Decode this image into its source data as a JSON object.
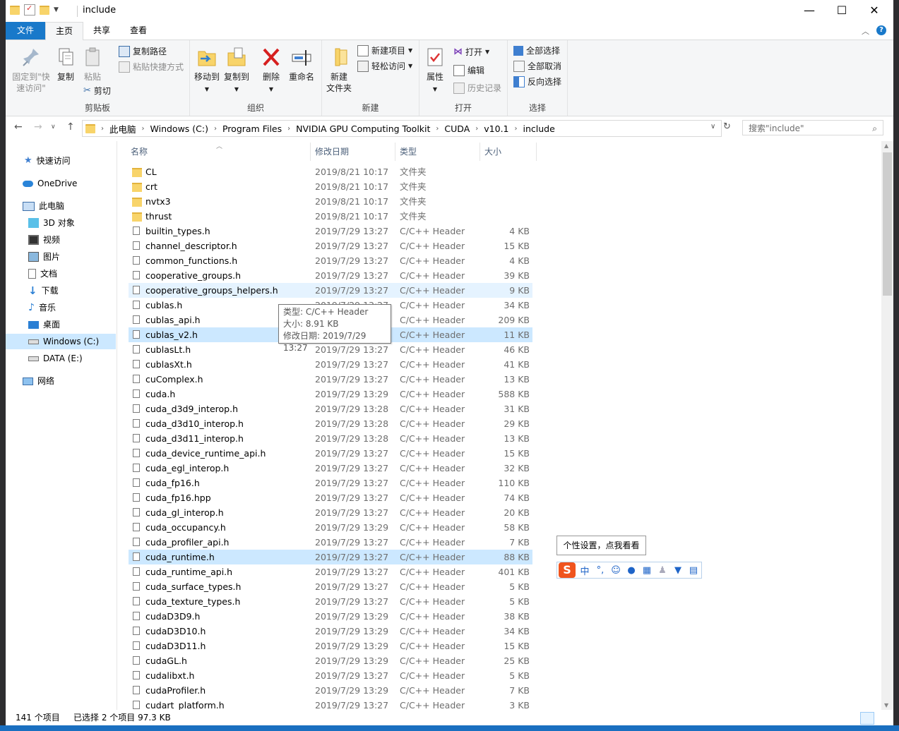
{
  "window": {
    "title": "include"
  },
  "tabs": {
    "file": "文件",
    "home": "主页",
    "share": "共享",
    "view": "查看"
  },
  "ribbon": {
    "clipboard": {
      "label": "剪贴板",
      "pin": "固定到\"快\n速访问\"",
      "copy": "复制",
      "paste": "粘贴",
      "copy_path": "复制路径",
      "paste_shortcut": "粘贴快捷方式",
      "cut": "剪切"
    },
    "organize": {
      "label": "组织",
      "move_to": "移动到",
      "copy_to": "复制到",
      "delete": "删除",
      "rename": "重命名"
    },
    "new": {
      "label": "新建",
      "new_folder": "新建\n文件夹",
      "new_item": "新建项目",
      "easy_access": "轻松访问"
    },
    "open": {
      "label": "打开",
      "properties": "属性",
      "open": "打开",
      "edit": "编辑",
      "history": "历史记录"
    },
    "select": {
      "label": "选择",
      "select_all": "全部选择",
      "select_none": "全部取消",
      "invert": "反向选择"
    }
  },
  "address": {
    "crumbs": [
      "此电脑",
      "Windows (C:)",
      "Program Files",
      "NVIDIA GPU Computing Toolkit",
      "CUDA",
      "v10.1",
      "include"
    ],
    "search_placeholder": "搜索\"include\""
  },
  "nav": {
    "quick_access": "快速访问",
    "onedrive": "OneDrive",
    "this_pc": "此电脑",
    "objects3d": "3D 对象",
    "videos": "视频",
    "pictures": "图片",
    "documents": "文档",
    "downloads": "下载",
    "music": "音乐",
    "desktop": "桌面",
    "windows_c": "Windows (C:)",
    "data_e": "DATA (E:)",
    "network": "网络"
  },
  "columns": {
    "name": "名称",
    "date": "修改日期",
    "type": "类型",
    "size": "大小"
  },
  "files": [
    {
      "name": "CL",
      "date": "2019/8/21 10:17",
      "type": "文件夹",
      "size": "",
      "folder": true
    },
    {
      "name": "crt",
      "date": "2019/8/21 10:17",
      "type": "文件夹",
      "size": "",
      "folder": true
    },
    {
      "name": "nvtx3",
      "date": "2019/8/21 10:17",
      "type": "文件夹",
      "size": "",
      "folder": true
    },
    {
      "name": "thrust",
      "date": "2019/8/21 10:17",
      "type": "文件夹",
      "size": "",
      "folder": true
    },
    {
      "name": "builtin_types.h",
      "date": "2019/7/29 13:27",
      "type": "C/C++ Header",
      "size": "4 KB"
    },
    {
      "name": "channel_descriptor.h",
      "date": "2019/7/29 13:27",
      "type": "C/C++ Header",
      "size": "15 KB"
    },
    {
      "name": "common_functions.h",
      "date": "2019/7/29 13:27",
      "type": "C/C++ Header",
      "size": "4 KB"
    },
    {
      "name": "cooperative_groups.h",
      "date": "2019/7/29 13:27",
      "type": "C/C++ Header",
      "size": "39 KB"
    },
    {
      "name": "cooperative_groups_helpers.h",
      "date": "2019/7/29 13:27",
      "type": "C/C++ Header",
      "size": "9 KB",
      "state": "hover"
    },
    {
      "name": "cublas.h",
      "date": "2019/7/29 13:27",
      "type": "C/C++ Header",
      "size": "34 KB"
    },
    {
      "name": "cublas_api.h",
      "date": "2019/7/29 13:27",
      "type": "C/C++ Header",
      "size": "209 KB"
    },
    {
      "name": "cublas_v2.h",
      "date": "2019/7/29 13:27",
      "type": "C/C++ Header",
      "size": "11 KB",
      "state": "sel"
    },
    {
      "name": "cublasLt.h",
      "date": "2019/7/29 13:27",
      "type": "C/C++ Header",
      "size": "46 KB"
    },
    {
      "name": "cublasXt.h",
      "date": "2019/7/29 13:27",
      "type": "C/C++ Header",
      "size": "41 KB"
    },
    {
      "name": "cuComplex.h",
      "date": "2019/7/29 13:27",
      "type": "C/C++ Header",
      "size": "13 KB"
    },
    {
      "name": "cuda.h",
      "date": "2019/7/29 13:29",
      "type": "C/C++ Header",
      "size": "588 KB"
    },
    {
      "name": "cuda_d3d9_interop.h",
      "date": "2019/7/29 13:28",
      "type": "C/C++ Header",
      "size": "31 KB"
    },
    {
      "name": "cuda_d3d10_interop.h",
      "date": "2019/7/29 13:28",
      "type": "C/C++ Header",
      "size": "29 KB"
    },
    {
      "name": "cuda_d3d11_interop.h",
      "date": "2019/7/29 13:28",
      "type": "C/C++ Header",
      "size": "13 KB"
    },
    {
      "name": "cuda_device_runtime_api.h",
      "date": "2019/7/29 13:27",
      "type": "C/C++ Header",
      "size": "15 KB"
    },
    {
      "name": "cuda_egl_interop.h",
      "date": "2019/7/29 13:27",
      "type": "C/C++ Header",
      "size": "32 KB"
    },
    {
      "name": "cuda_fp16.h",
      "date": "2019/7/29 13:27",
      "type": "C/C++ Header",
      "size": "110 KB"
    },
    {
      "name": "cuda_fp16.hpp",
      "date": "2019/7/29 13:27",
      "type": "C/C++ Header",
      "size": "74 KB"
    },
    {
      "name": "cuda_gl_interop.h",
      "date": "2019/7/29 13:27",
      "type": "C/C++ Header",
      "size": "20 KB"
    },
    {
      "name": "cuda_occupancy.h",
      "date": "2019/7/29 13:29",
      "type": "C/C++ Header",
      "size": "58 KB"
    },
    {
      "name": "cuda_profiler_api.h",
      "date": "2019/7/29 13:27",
      "type": "C/C++ Header",
      "size": "7 KB"
    },
    {
      "name": "cuda_runtime.h",
      "date": "2019/7/29 13:27",
      "type": "C/C++ Header",
      "size": "88 KB",
      "state": "sel"
    },
    {
      "name": "cuda_runtime_api.h",
      "date": "2019/7/29 13:27",
      "type": "C/C++ Header",
      "size": "401 KB"
    },
    {
      "name": "cuda_surface_types.h",
      "date": "2019/7/29 13:27",
      "type": "C/C++ Header",
      "size": "5 KB"
    },
    {
      "name": "cuda_texture_types.h",
      "date": "2019/7/29 13:27",
      "type": "C/C++ Header",
      "size": "5 KB"
    },
    {
      "name": "cudaD3D9.h",
      "date": "2019/7/29 13:29",
      "type": "C/C++ Header",
      "size": "38 KB"
    },
    {
      "name": "cudaD3D10.h",
      "date": "2019/7/29 13:29",
      "type": "C/C++ Header",
      "size": "34 KB"
    },
    {
      "name": "cudaD3D11.h",
      "date": "2019/7/29 13:29",
      "type": "C/C++ Header",
      "size": "15 KB"
    },
    {
      "name": "cudaGL.h",
      "date": "2019/7/29 13:29",
      "type": "C/C++ Header",
      "size": "25 KB"
    },
    {
      "name": "cudalibxt.h",
      "date": "2019/7/29 13:27",
      "type": "C/C++ Header",
      "size": "5 KB"
    },
    {
      "name": "cudaProfiler.h",
      "date": "2019/7/29 13:29",
      "type": "C/C++ Header",
      "size": "7 KB"
    },
    {
      "name": "cudart_platform.h",
      "date": "2019/7/29 13:27",
      "type": "C/C++ Header",
      "size": "3 KB"
    }
  ],
  "tooltip": {
    "type": "类型: C/C++ Header",
    "size": "大小: 8.91 KB",
    "date": "修改日期: 2019/7/29 13:27"
  },
  "status": {
    "count": "141 个项目",
    "selected": "已选择 2 个项目  97.3 KB"
  },
  "ime": {
    "tip": "个性设置，点我看看",
    "mode": "中",
    "punct": "°,"
  },
  "colors": {
    "accent": "#1979ca",
    "selection": "#cce8ff",
    "hover": "#e5f3ff"
  }
}
